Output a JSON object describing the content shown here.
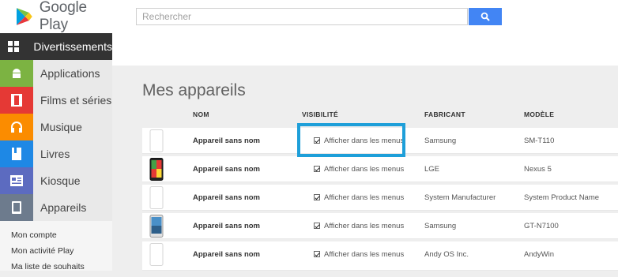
{
  "header": {
    "logo_text": "Google Play",
    "search_placeholder": "Rechercher"
  },
  "sidebar": {
    "items": [
      {
        "label": "Divertissements",
        "color": "#333333",
        "icon": "grid-icon"
      },
      {
        "label": "Applications",
        "color": "#7cb342",
        "icon": "android-icon"
      },
      {
        "label": "Films et séries",
        "color": "#e53935",
        "icon": "film-icon"
      },
      {
        "label": "Musique",
        "color": "#fb8c00",
        "icon": "headphones-icon"
      },
      {
        "label": "Livres",
        "color": "#1e88e5",
        "icon": "book-icon"
      },
      {
        "label": "Kiosque",
        "color": "#5c6bc0",
        "icon": "newspaper-icon"
      },
      {
        "label": "Appareils",
        "color": "#6d7b8d",
        "icon": "device-icon"
      }
    ],
    "links": [
      "Mon compte",
      "Mon activité Play",
      "Ma liste de souhaits"
    ]
  },
  "main": {
    "title": "Mes appareils",
    "columns": [
      "NOM",
      "VISIBILITÉ",
      "FABRICANT",
      "MODÈLE"
    ],
    "rows": [
      {
        "name": "Appareil sans nom",
        "visibility": "Afficher dans les menus",
        "manufacturer": "Samsung",
        "model": "SM-T110"
      },
      {
        "name": "Appareil sans nom",
        "visibility": "Afficher dans les menus",
        "manufacturer": "LGE",
        "model": "Nexus 5"
      },
      {
        "name": "Appareil sans nom",
        "visibility": "Afficher dans les menus",
        "manufacturer": "System Manufacturer",
        "model": "System Product Name"
      },
      {
        "name": "Appareil sans nom",
        "visibility": "Afficher dans les menus",
        "manufacturer": "Samsung",
        "model": "GT-N7100"
      },
      {
        "name": "Appareil sans nom",
        "visibility": "Afficher dans les menus",
        "manufacturer": "Andy OS Inc.",
        "model": "AndyWin"
      }
    ]
  },
  "colors": {
    "search_button": "#4285f4",
    "highlight": "#1e9fd9"
  }
}
